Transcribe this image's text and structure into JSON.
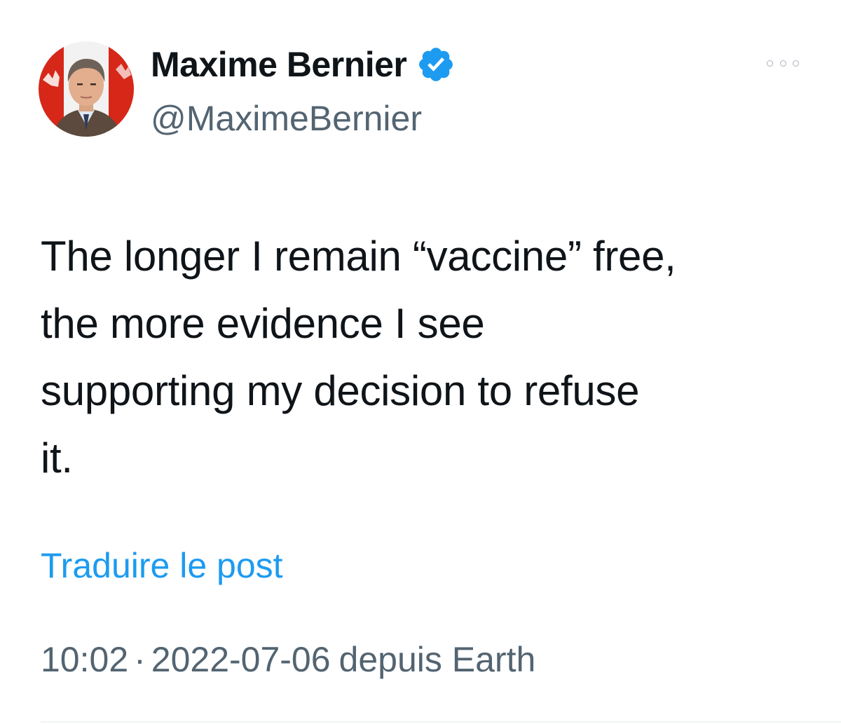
{
  "author": {
    "display_name": "Maxime Bernier",
    "handle": "@MaximeBernier",
    "verified": true,
    "avatar_icon": "profile-photo"
  },
  "tweet": {
    "text_lines": [
      "The longer I remain “vaccine” free,",
      "the more evidence I see",
      "supporting my decision to refuse",
      "it."
    ],
    "translate_label": "Traduire le post",
    "time": "10:02",
    "separator": "·",
    "date": "2022-07-06",
    "source": "depuis Earth"
  },
  "icons": {
    "more": "more-options-icon",
    "verified": "verified-badge-icon"
  },
  "colors": {
    "text_primary": "#0f1419",
    "text_secondary": "#536471",
    "link": "#1d9bf0",
    "verified_badge": "#1d9bf0"
  }
}
